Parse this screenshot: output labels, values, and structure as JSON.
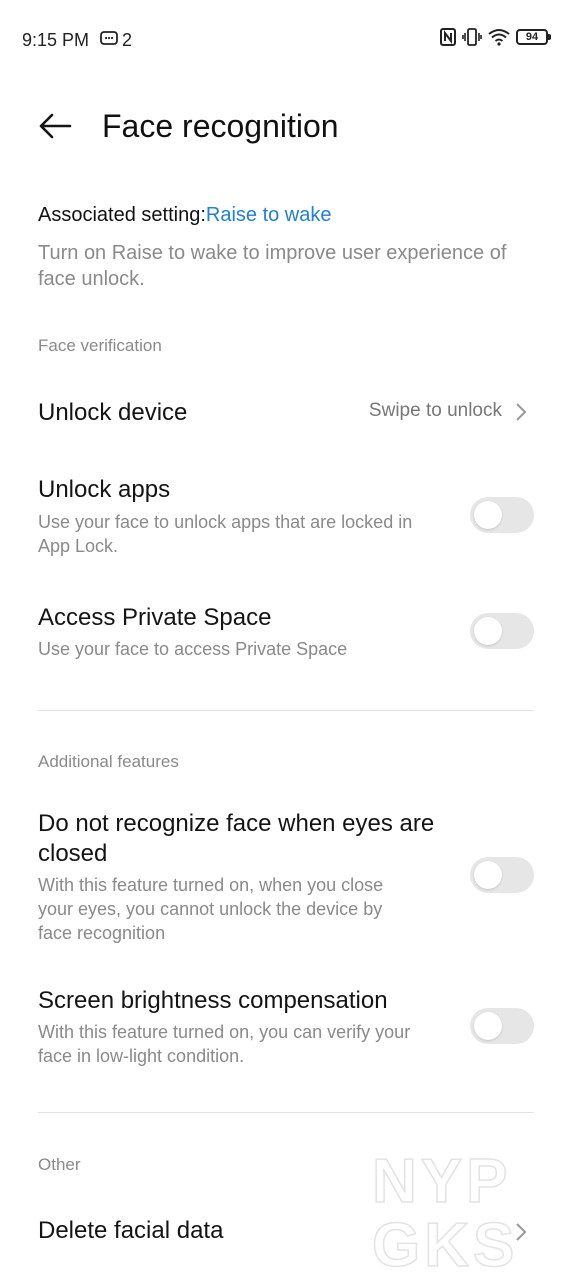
{
  "status_bar": {
    "time": "9:15 PM",
    "notification_count": "2",
    "battery": "94",
    "icons": [
      "message-icon",
      "nfc-icon",
      "vibrate-icon",
      "wifi-icon",
      "battery-icon"
    ]
  },
  "header": {
    "title": "Face recognition"
  },
  "associated": {
    "prefix": "Associated setting:",
    "link": "Raise to wake",
    "description": "Turn on Raise to wake to improve user experience of face unlock."
  },
  "sections": {
    "face_verification": "Face verification",
    "additional_features": "Additional features",
    "other": "Other"
  },
  "rows": {
    "unlock_device": {
      "title": "Unlock device",
      "value": "Swipe to unlock"
    },
    "unlock_apps": {
      "title": "Unlock apps",
      "subtitle": "Use your face to unlock apps that are locked in App Lock.",
      "enabled": false
    },
    "private_space": {
      "title": "Access Private Space",
      "subtitle": "Use your face to access Private Space",
      "enabled": false
    },
    "eyes_closed": {
      "title": "Do not recognize face when eyes are closed",
      "subtitle": "With this feature turned on, when you close your eyes, you cannot unlock the device by face recognition",
      "enabled": false
    },
    "brightness": {
      "title": "Screen brightness compensation",
      "subtitle": "With this feature turned on, you can verify your face in low-light condition.",
      "enabled": false
    },
    "delete_data": {
      "title": "Delete facial data"
    }
  },
  "watermark": {
    "text_top": "NYP",
    "text_bottom": "GKS"
  },
  "colors": {
    "accent": "#1e80d8",
    "toggle_off": "#e6e6e6",
    "secondary_text": "#8a8a8a"
  }
}
